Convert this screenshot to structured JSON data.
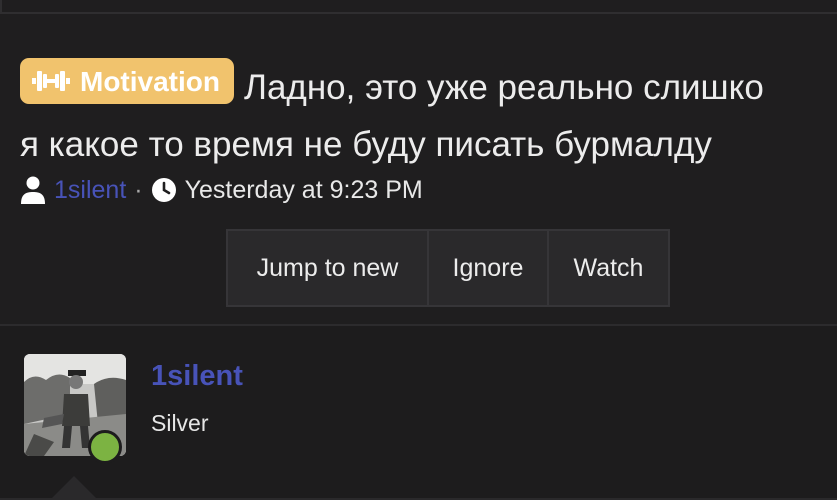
{
  "thread": {
    "prefix_label": "Motivation",
    "prefix_icon": "dumbbell-icon",
    "prefix_color": "#f1c36d",
    "title_line1": "Ладно, это уже реально слишко",
    "title_line2": "я какое то время не буду писать бурмалду",
    "author": "1silent",
    "separator": "·",
    "timestamp": "Yesterday at 9:23 PM"
  },
  "actions": {
    "jump_label": "Jump to new",
    "ignore_label": "Ignore",
    "watch_label": "Watch"
  },
  "post": {
    "username": "1silent",
    "user_title": "Silver",
    "online_status_color": "#7cb342",
    "username_color": "#4853b8"
  }
}
